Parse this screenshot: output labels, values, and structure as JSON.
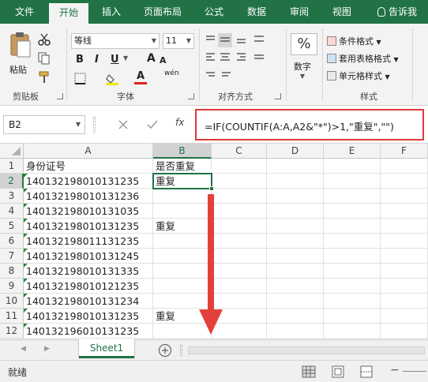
{
  "menu": {
    "tabs": [
      "文件",
      "开始",
      "插入",
      "页面布局",
      "公式",
      "数据",
      "审阅",
      "视图"
    ],
    "active": "开始",
    "tell_me": "告诉我"
  },
  "ribbon": {
    "clipboard": {
      "paste": "粘贴",
      "label": "剪贴板"
    },
    "font": {
      "name": "等线",
      "size": "11",
      "label": "字体",
      "underline_letter": "U",
      "bold": "B",
      "italic": "I",
      "font_color": "A",
      "phonetic": "wén",
      "grow": "A",
      "shrink": "A"
    },
    "align": {
      "label": "对齐方式"
    },
    "number": {
      "percent": "%",
      "label": "数字"
    },
    "styles": {
      "conditional": "条件格式",
      "table": "套用表格格式",
      "cell": "单元格样式",
      "label": "样式"
    }
  },
  "formula_bar": {
    "name_box": "B2",
    "fx": "fx",
    "formula": "=IF(COUNTIF(A:A,A2&\"*\")>1,\"重复\",\"\")"
  },
  "grid": {
    "columns": [
      "A",
      "B",
      "C",
      "D",
      "E",
      "F"
    ],
    "selected_column": "B",
    "rows": [
      {
        "num": "1",
        "a": "身份证号",
        "b": "是否重复"
      },
      {
        "num": "2",
        "a": "140132198010131235",
        "b": "重复"
      },
      {
        "num": "3",
        "a": "140132198010131236",
        "b": ""
      },
      {
        "num": "4",
        "a": "140132198010131035",
        "b": ""
      },
      {
        "num": "5",
        "a": "140132198010131235",
        "b": "重复"
      },
      {
        "num": "6",
        "a": "140132198011131235",
        "b": ""
      },
      {
        "num": "7",
        "a": "140132198010131245",
        "b": ""
      },
      {
        "num": "8",
        "a": "140132198010131335",
        "b": ""
      },
      {
        "num": "9",
        "a": "140132198010121235",
        "b": ""
      },
      {
        "num": "10",
        "a": "140132198010131234",
        "b": ""
      },
      {
        "num": "11",
        "a": "140132198010131235",
        "b": "重复"
      },
      {
        "num": "12",
        "a": "140132196010131235",
        "b": ""
      }
    ],
    "selected_row": "2"
  },
  "sheets": {
    "tabs": [
      "Sheet1"
    ],
    "active": "Sheet1"
  },
  "status": {
    "text": "就绪"
  },
  "colors": {
    "excel_green": "#217346",
    "highlight_red": "#e03a35",
    "arrow_red": "#e4403b"
  }
}
